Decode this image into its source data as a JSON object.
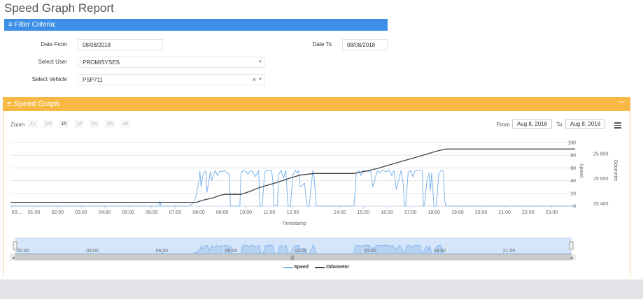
{
  "page": {
    "title": "Speed Graph Report"
  },
  "filter": {
    "header": "≡ Filter Criteria:",
    "date_from_label": "Date From",
    "date_from_value": "08/08/2018",
    "date_to_label": "Date To",
    "date_to_value": "08/08/2018",
    "user_label": "Select User",
    "user_value": "PROMISYSES",
    "vehicle_label": "Select Vehicle",
    "vehicle_value": "PSP711"
  },
  "graph_panel": {
    "header": "≡ Speed Graph",
    "zoom_label": "Zoom",
    "zoom_buttons": [
      "1s",
      "1m",
      "1h",
      "1d",
      "1w",
      "1m",
      "All"
    ],
    "zoom_active": "1h",
    "from_label": "From",
    "from_value": "Aug 8, 2018",
    "to_label": "To",
    "to_value": "Aug 8, 2018"
  },
  "colors": {
    "filter_header": "#3d8fe6",
    "graph_header": "#f7b944",
    "speed": "#7cb5ec",
    "odometer": "#434348"
  },
  "chart_data": {
    "type": "line",
    "xlabel": "Timestamp",
    "x_ticks": [
      "00:...",
      "01:00",
      "02:00",
      "03:00",
      "04:00",
      "05:00",
      "06:00",
      "07:00",
      "08:00",
      "09:00",
      "10:00",
      "11:00",
      "12:00",
      "14:00",
      "15:00",
      "16:00",
      "17:00",
      "18:00",
      "19:00",
      "20:00",
      "21:00",
      "22:00",
      "23:00"
    ],
    "x_tick_hours": [
      0.05,
      1,
      2,
      3,
      4,
      5,
      6,
      7,
      8,
      9,
      10,
      11,
      12,
      14,
      15,
      16,
      17,
      18,
      19,
      20,
      21,
      22,
      23
    ],
    "xlim": [
      0,
      24
    ],
    "y_axes": [
      {
        "name": "Speed",
        "ticks": [
          0,
          20,
          40,
          60,
          80,
          100
        ],
        "ylim": [
          0,
          100
        ]
      },
      {
        "name": "Odometer",
        "ticks": [
          "25 400",
          "25 600",
          "25 800"
        ],
        "tick_values": [
          25400,
          25600,
          25800
        ],
        "ylim": [
          25380,
          25890
        ]
      }
    ],
    "series": [
      {
        "name": "Speed",
        "axis": 0,
        "x": [
          0,
          6.3,
          6.35,
          6.4,
          7.6,
          7.8,
          7.9,
          8.0,
          8.05,
          8.1,
          8.2,
          8.3,
          8.35,
          8.5,
          8.55,
          8.7,
          8.8,
          8.9,
          9.0,
          9.1,
          9.2,
          9.3,
          9.35,
          9.75,
          9.8,
          9.9,
          10.0,
          10.1,
          10.2,
          10.3,
          10.4,
          10.55,
          10.6,
          10.7,
          10.8,
          10.85,
          10.9,
          11.1,
          11.15,
          11.2,
          11.35,
          11.4,
          11.5,
          11.6,
          11.7,
          11.8,
          11.9,
          12.0,
          12.1,
          12.2,
          12.25,
          12.3,
          12.5,
          12.6,
          12.7,
          12.85,
          12.9,
          13.0,
          14.6,
          14.7,
          14.8,
          14.9,
          15.0,
          15.2,
          15.3,
          15.4,
          15.6,
          15.7,
          15.8,
          16.0,
          16.1,
          16.2,
          16.3,
          16.4,
          16.6,
          16.7,
          16.75,
          16.8,
          16.9,
          17.0,
          17.1,
          17.2,
          17.5,
          17.55,
          17.6,
          17.7,
          17.8,
          17.85,
          17.9,
          18.0,
          18.1,
          18.2,
          18.3,
          18.4,
          18.45,
          18.5,
          24
        ],
        "y": [
          0,
          0,
          8,
          0,
          0,
          6,
          18,
          38,
          55,
          30,
          52,
          55,
          22,
          54,
          40,
          56,
          48,
          55,
          54,
          56,
          52,
          50,
          0,
          0,
          52,
          56,
          55,
          50,
          56,
          54,
          46,
          56,
          0,
          0,
          52,
          55,
          56,
          56,
          40,
          0,
          2,
          50,
          56,
          44,
          56,
          0,
          0,
          48,
          56,
          52,
          56,
          30,
          36,
          0,
          0,
          56,
          48,
          0,
          0,
          52,
          56,
          48,
          56,
          54,
          56,
          30,
          56,
          52,
          56,
          54,
          57,
          48,
          56,
          26,
          56,
          34,
          0,
          0,
          52,
          56,
          46,
          56,
          56,
          0,
          2,
          40,
          52,
          24,
          52,
          0,
          0,
          50,
          56,
          56,
          10,
          0,
          0
        ]
      },
      {
        "name": "Odometer",
        "axis": 1,
        "x": [
          0,
          7.9,
          8.2,
          8.6,
          8.9,
          9.1,
          9.8,
          10.2,
          10.6,
          10.9,
          11.3,
          11.8,
          12.3,
          12.9,
          14.6,
          15.1,
          15.6,
          16.1,
          16.6,
          17.1,
          17.6,
          18.1,
          18.5,
          24
        ],
        "y": [
          25410,
          25410,
          25428,
          25446,
          25466,
          25474,
          25474,
          25500,
          25530,
          25546,
          25568,
          25600,
          25628,
          25642,
          25642,
          25660,
          25682,
          25710,
          25738,
          25764,
          25792,
          25820,
          25838,
          25838
        ]
      }
    ],
    "navigator_ticks": [
      "00:00",
      "03:00",
      "06:00",
      "09:00",
      "12:00",
      "15:00",
      "18:00",
      "21:00"
    ],
    "navigator_tick_hours": [
      0,
      3,
      6,
      9,
      12,
      15,
      18,
      21
    ],
    "legend": [
      "Speed",
      "Odometer"
    ],
    "legend_position": "bottom-center"
  }
}
